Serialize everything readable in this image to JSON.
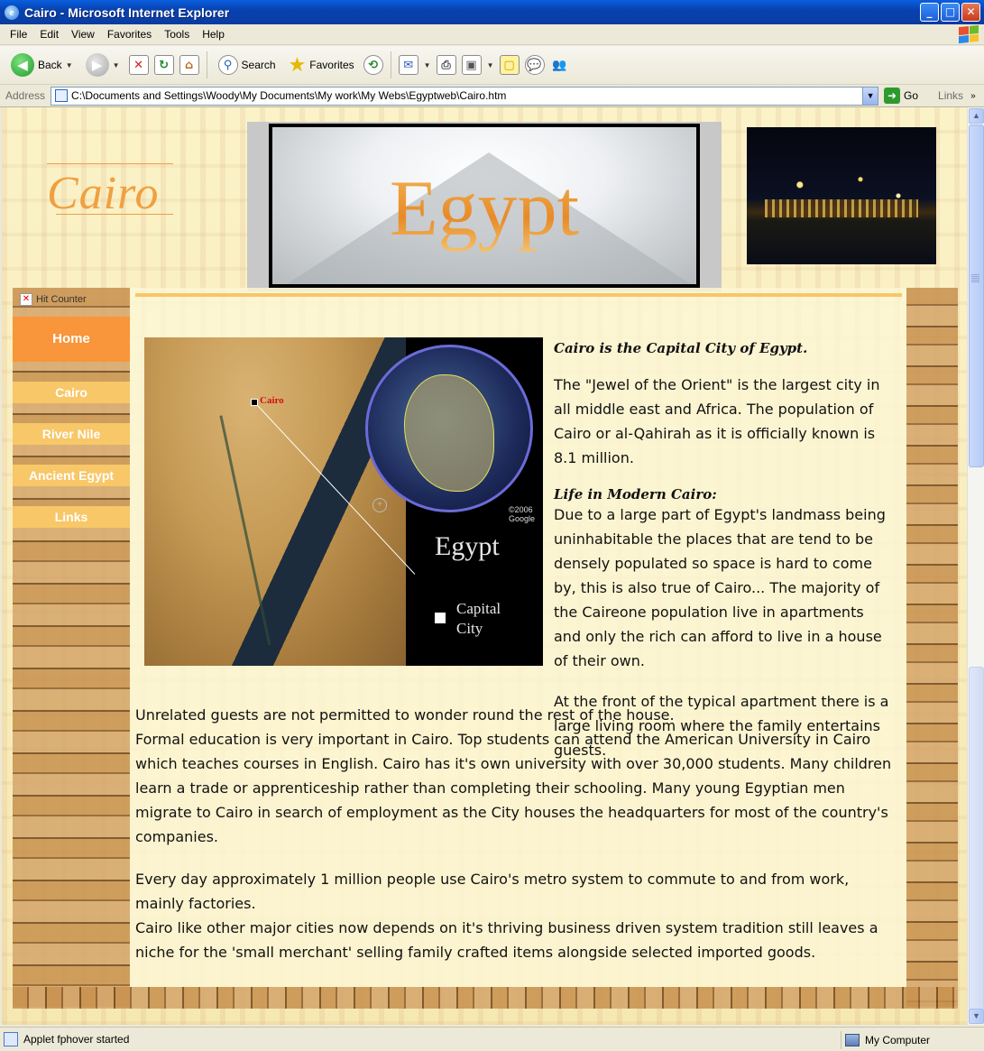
{
  "window": {
    "title": "Cairo - Microsoft Internet Explorer",
    "minimize": "_",
    "maximize": "□",
    "close": "✕"
  },
  "menu": [
    "File",
    "Edit",
    "View",
    "Favorites",
    "Tools",
    "Help"
  ],
  "toolbar": {
    "back": "Back",
    "search": "Search",
    "favorites": "Favorites"
  },
  "address": {
    "label": "Address",
    "value": "C:\\Documents and Settings\\Woody\\My Documents\\My work\\My Webs\\Egyptweb\\Cairo.htm",
    "go": "Go",
    "links": "Links"
  },
  "page": {
    "logo": "Cairo",
    "banner_title": "Egypt",
    "hit_counter": "Hit Counter",
    "nav": {
      "home": "Home",
      "items": [
        "Cairo",
        "River Nile",
        "Ancient Egypt",
        "Links"
      ]
    },
    "map": {
      "cairo_label": "Cairo",
      "egypt_label": "Egypt",
      "capital_label": "Capital City",
      "google": "©2006 Google"
    },
    "heading": "Cairo is the Capital City of Egypt.",
    "intro": "The \"Jewel of the Orient\" is the largest city in all middle east and Africa. The population of Cairo or al-Qahirah as it is officially known is 8.1 million.",
    "modern_heading": "Life in Modern Cairo:",
    "modern_text": "Due to a large part of Egypt's landmass being uninhabitable the places that are tend to be densely populated so space is hard to come by, this is also true of Cairo... The majority of the Caireone population live in apartments and only the rich can afford to live in a house of their own.",
    "apartment_text": "At the front of the typical apartment there is a large living room where the family entertains guests.",
    "guests_text": "Unrelated guests are not permitted to wonder round the rest of the house.",
    "education_text": "Formal education is very important in Cairo. Top students can attend the American University in Cairo which teaches courses in English. Cairo has it's own university with over 30,000 students. Many children learn a trade or apprenticeship rather than completing their schooling. Many young Egyptian men migrate to Cairo in search of employment as the City houses the headquarters for most of the country's companies.",
    "metro_text": "Every day approximately 1 million people use Cairo's metro system to commute to and from work, mainly factories.",
    "business_text": "Cairo like other major cities now depends on it's thriving business driven system tradition still leaves a niche for the 'small merchant' selling family crafted items alongside selected imported goods."
  },
  "status": {
    "text": "Applet fphover started",
    "zone": "My Computer"
  },
  "colors": {
    "nav_home": "#f9953a",
    "nav_item": "#f8c768",
    "accent_rule": "#f7c66a",
    "logo": "#f0a040"
  },
  "icons": [
    "ie-icon",
    "back-arrow-icon",
    "forward-arrow-icon",
    "stop-icon",
    "refresh-icon",
    "home-icon",
    "search-icon",
    "favorites-star-icon",
    "history-icon",
    "mail-icon",
    "print-icon",
    "edit-icon",
    "discuss-icon",
    "messenger-icon",
    "go-arrow-icon",
    "windows-logo-icon"
  ]
}
